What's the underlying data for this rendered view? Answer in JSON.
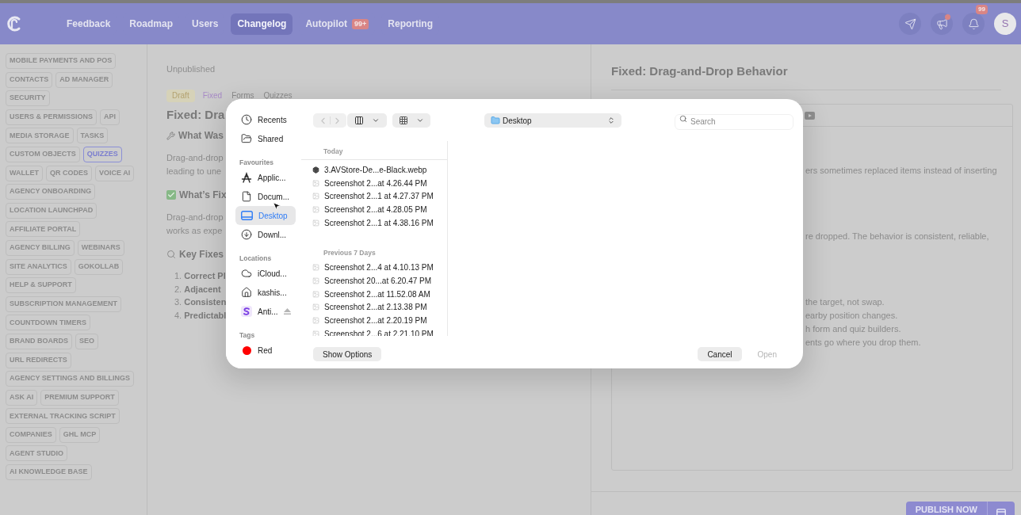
{
  "nav": {
    "items": [
      {
        "label": "Feedback",
        "selected": false
      },
      {
        "label": "Roadmap",
        "selected": false
      },
      {
        "label": "Users",
        "selected": false
      },
      {
        "label": "Changelog",
        "selected": true
      },
      {
        "label": "Autopilot",
        "selected": false,
        "badge": "99+"
      },
      {
        "label": "Reporting",
        "selected": false
      }
    ],
    "actions": [
      {
        "kind": "send"
      },
      {
        "kind": "megaphone",
        "dot": true
      },
      {
        "kind": "bell",
        "badge": "99"
      }
    ],
    "avatar": "S"
  },
  "sidebar": {
    "tags": [
      {
        "label": "MOBILE PAYMENTS AND POS",
        "selected": false
      },
      {
        "label": "CONTACTS",
        "selected": false
      },
      {
        "label": "AD MANAGER",
        "selected": false
      },
      {
        "label": "SECURITY",
        "selected": false
      },
      {
        "label": "USERS & PERMISSIONS",
        "selected": false
      },
      {
        "label": "API",
        "selected": false
      },
      {
        "label": "MEDIA STORAGE",
        "selected": false
      },
      {
        "label": "TASKS",
        "selected": false
      },
      {
        "label": "CUSTOM OBJECTS",
        "selected": false
      },
      {
        "label": "QUIZZES",
        "selected": true
      },
      {
        "label": "WALLET",
        "selected": false
      },
      {
        "label": "QR CODES",
        "selected": false
      },
      {
        "label": "VOICE AI",
        "selected": false
      },
      {
        "label": "AGENCY ONBOARDING",
        "selected": false
      },
      {
        "label": "LOCATION LAUNCHPAD",
        "selected": false
      },
      {
        "label": "AFFILIATE PORTAL",
        "selected": false
      },
      {
        "label": "AGENCY BILLING",
        "selected": false
      },
      {
        "label": "WEBINARS",
        "selected": false
      },
      {
        "label": "SITE ANALYTICS",
        "selected": false
      },
      {
        "label": "GOKOLLAB",
        "selected": false
      },
      {
        "label": "HELP & SUPPORT",
        "selected": false
      },
      {
        "label": "SUBSCRIPTION MANAGEMENT",
        "selected": false
      },
      {
        "label": "COUNTDOWN TIMERS",
        "selected": false
      },
      {
        "label": "BRAND BOARDS",
        "selected": false
      },
      {
        "label": "SEO",
        "selected": false
      },
      {
        "label": "URL REDIRECTS",
        "selected": false
      },
      {
        "label": "AGENCY SETTINGS AND BILLINGS",
        "selected": false
      },
      {
        "label": "ASK AI",
        "selected": false
      },
      {
        "label": "PREMIUM SUPPORT",
        "selected": false
      },
      {
        "label": "EXTERNAL TRACKING SCRIPT",
        "selected": false
      },
      {
        "label": "COMPANIES",
        "selected": false
      },
      {
        "label": "GHL MCP",
        "selected": false
      },
      {
        "label": "AGENT STUDIO",
        "selected": false
      },
      {
        "label": "AI KNOWLEDGE BASE",
        "selected": false
      }
    ]
  },
  "editor": {
    "status": "Unpublished",
    "labels": [
      {
        "label": "Draft",
        "kind": "status"
      },
      {
        "label": "Fixed",
        "kind": "type"
      },
      {
        "label": "Forms",
        "kind": "product"
      },
      {
        "label": "Quizzes",
        "kind": "product"
      }
    ],
    "title": "Fixed: Dra",
    "blocks": [
      {
        "kind": "heading",
        "text": "What Was"
      },
      {
        "kind": "paragraph",
        "lines": [
          "Drag-and-drop",
          "leading to une"
        ]
      },
      {
        "kind": "heading",
        "text": "What’s Fix"
      },
      {
        "kind": "paragraph",
        "lines": [
          "Drag-and-drop",
          "works as expe"
        ]
      },
      {
        "kind": "heading",
        "text": "Key Fixes"
      },
      {
        "kind": "list",
        "items": [
          {
            "number": "1.",
            "text": "Correct Pl"
          },
          {
            "number": "2.",
            "text": "Adjacent"
          },
          {
            "number": "3.",
            "text": "Consisten"
          },
          {
            "number": "4.",
            "text": "Predictabl"
          }
        ]
      }
    ]
  },
  "preview": {
    "title": "Fixed: Drag-and-Drop Behavior",
    "paragraphs": [
      [
        "ers sometimes replaced items instead of inserting"
      ],
      [
        "re dropped. The behavior is consistent, reliable,"
      ],
      [
        "the target, not swap.",
        "earby position changes.",
        "h form and quiz builders.",
        "ents go where you drop them."
      ]
    ],
    "publish": "PUBLISH NOW"
  },
  "dialog": {
    "sections": [
      {
        "items": [
          {
            "kind": "recents",
            "label": "Recents",
            "selected": false
          },
          {
            "kind": "shared",
            "label": "Shared",
            "selected": false
          }
        ]
      },
      {
        "heading": "Favourites",
        "items": [
          {
            "kind": "applications",
            "label": "Applic...",
            "selected": false
          },
          {
            "kind": "documents",
            "label": "Docum...",
            "selected": false
          },
          {
            "kind": "desktop",
            "label": "Desktop",
            "selected": true
          },
          {
            "kind": "downloads",
            "label": "Downl...",
            "selected": false
          }
        ]
      },
      {
        "heading": "Locations",
        "items": [
          {
            "kind": "icloud",
            "label": "iCloud...",
            "selected": false
          },
          {
            "kind": "home",
            "label": "kashis...",
            "selected": false
          },
          {
            "kind": "volume",
            "label": "Anti...",
            "selected": false
          }
        ]
      },
      {
        "heading": "Tags",
        "items": [
          {
            "kind": "tag",
            "label": "Red",
            "selected": false,
            "color": "#ff0000"
          }
        ]
      }
    ],
    "back": {
      "disabled": true
    },
    "forward": {
      "disabled": true
    },
    "location": "Desktop",
    "search": {
      "placeholder": "Search"
    },
    "groups": [
      {
        "heading": "Today",
        "files": [
          {
            "kind": "archive",
            "name": "3.AVStore-De...e-Black.webp"
          },
          {
            "kind": "image",
            "name": "Screenshot 2...at 4.26.44 PM"
          },
          {
            "kind": "image",
            "name": "Screenshot 2...1 at 4.27.37 PM"
          },
          {
            "kind": "image",
            "name": "Screenshot 2...at 4.28.05 PM"
          },
          {
            "kind": "image",
            "name": "Screenshot 2...1 at 4.38.16 PM"
          }
        ]
      },
      {
        "heading": "Previous 7 Days",
        "files": [
          {
            "kind": "image",
            "name": "Screenshot 2...4 at 4.10.13 PM"
          },
          {
            "kind": "image",
            "name": "Screenshot 20...at 6.20.47 PM"
          },
          {
            "kind": "image",
            "name": "Screenshot 2...at 11.52.08 AM"
          },
          {
            "kind": "image",
            "name": "Screenshot 2...at 2.13.38 PM"
          },
          {
            "kind": "image",
            "name": "Screenshot 2...at 2.20.19 PM"
          },
          {
            "kind": "image",
            "name": "Screenshot 2...6 at 2.21.10 PM"
          }
        ]
      }
    ],
    "show_options": "Show Options",
    "cancel": "Cancel",
    "open": {
      "label": "Open",
      "disabled": true
    }
  }
}
